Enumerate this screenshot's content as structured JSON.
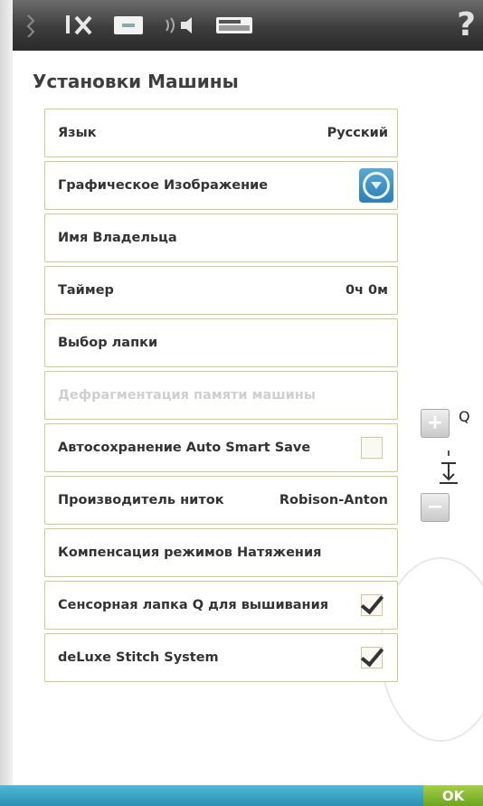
{
  "title": "Установки Машины",
  "rows": [
    {
      "label": "Язык",
      "value": "Русский"
    },
    {
      "label": "Графическое Изображение",
      "value": ""
    },
    {
      "label": "Имя Владельца",
      "value": ""
    },
    {
      "label": "Таймер",
      "value": "0ч 0м"
    },
    {
      "label": "Выбор лапки",
      "value": ""
    },
    {
      "label": "Дефрагментация памяти машины",
      "value": ""
    },
    {
      "label": "Автосохранение Auto Smart Save",
      "checked": false
    },
    {
      "label": "Производитель ниток",
      "value": "Robison-Anton"
    },
    {
      "label": "Компенсация режимов Натяжения",
      "value": ""
    },
    {
      "label": "Сенсорная лапка Q для вышивания",
      "checked": true
    },
    {
      "label": "deLuxe Stitch System",
      "checked": true
    }
  ],
  "toolbar": {
    "icons": [
      "menu-icon",
      "tools-icon",
      "machine-settings-icon",
      "sound-icon",
      "sewing-settings-icon",
      "help-icon"
    ],
    "help_label": "?"
  },
  "side": {
    "q_label": "Q",
    "plus": "+",
    "minus": "−"
  },
  "ok_label": "OK",
  "colors": {
    "row_border": "#c9ce8e",
    "topbar": "#3d3d3d",
    "bottom_bar": "#2b90b2",
    "ok": "#7db227"
  }
}
